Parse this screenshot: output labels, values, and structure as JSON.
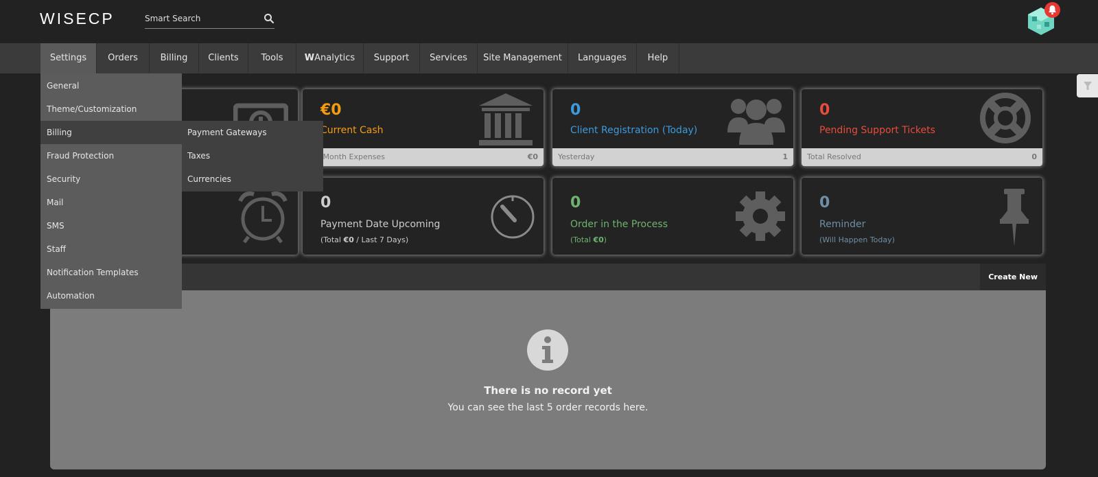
{
  "header": {
    "logo": "WISECP",
    "search_placeholder": "Smart Search"
  },
  "nav": {
    "items": [
      "Settings",
      "Orders",
      "Billing",
      "Clients",
      "Tools",
      "Analytics",
      "Support",
      "Services",
      "Site Management",
      "Languages",
      "Help"
    ],
    "analytics_prefix": "W",
    "active": "Settings"
  },
  "settings_menu": {
    "items": [
      "General",
      "Theme/Customization",
      "Billing",
      "Fraud Protection",
      "Security",
      "Mail",
      "SMS",
      "Staff",
      "Notification Templates",
      "Automation"
    ],
    "active": "Billing",
    "billing_submenu": [
      "Payment Gateways",
      "Taxes",
      "Currencies"
    ]
  },
  "cards": {
    "cash": {
      "value": "€0",
      "label": "Current Cash",
      "foot_label": "ent Month Expenses",
      "foot_value": "€0"
    },
    "clients": {
      "value": "0",
      "label": "Client Registration (Today)",
      "foot_label": "Yesterday",
      "foot_value": "1"
    },
    "tickets": {
      "value": "0",
      "label": "Pending Support Tickets",
      "foot_label": "Total Resolved",
      "foot_value": "0"
    },
    "payment": {
      "value": "0",
      "label": "Payment Date Upcoming",
      "sub_prefix": "(Total ",
      "sub_amount": "€0",
      "sub_suffix": " / Last 7 Days)"
    },
    "orders": {
      "value": "0",
      "label": "Order in the Process",
      "sub_prefix": "(Total ",
      "sub_amount": "€0",
      "sub_suffix": ")"
    },
    "reminder": {
      "value": "0",
      "label": "Reminder",
      "sub": "(Will Happen Today)"
    }
  },
  "records": {
    "create_label": "Create New",
    "empty_title": "There is no record yet",
    "empty_text": "You can see the last 5 order records here."
  },
  "colors": {
    "cash": "#f39c12",
    "clients": "#3d9bdc",
    "tickets": "#e74c3c",
    "payment": "#cccccc",
    "orders": "#6fb36f",
    "reminder": "#6e8fa6"
  }
}
